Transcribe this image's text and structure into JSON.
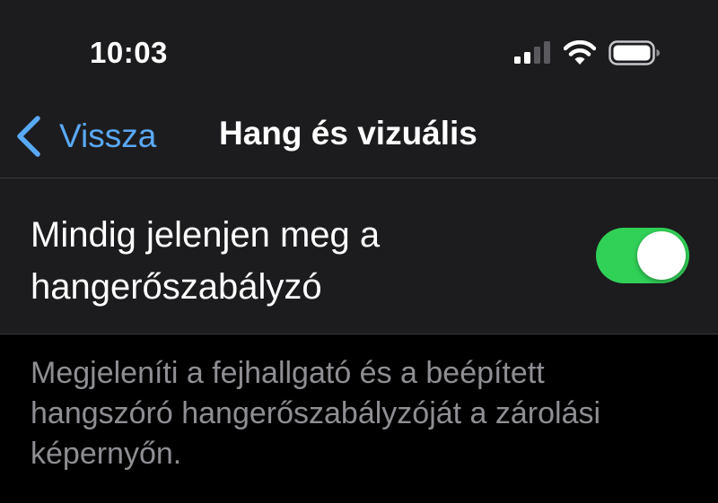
{
  "status_bar": {
    "time": "10:03",
    "icons": [
      "cellular-signal-icon",
      "wifi-icon",
      "battery-icon"
    ]
  },
  "nav_bar": {
    "back_label": "Vissza",
    "back_icon": "chevron-left-icon",
    "title": "Hang és vizuális"
  },
  "setting": {
    "label": "Mindig jelenjen meg a hangerőszabályzó",
    "toggle_on": true
  },
  "footer": {
    "description": "Megjeleníti a fejhallgató és a beépített hangszóró hangerőszabályzóját a zárolási képernyőn."
  },
  "colors": {
    "accent": "#5aa9f6",
    "toggle_on": "#31d158",
    "cell_background": "#1c1c1e",
    "page_background": "#000000",
    "secondary_text": "#8e8e93"
  }
}
